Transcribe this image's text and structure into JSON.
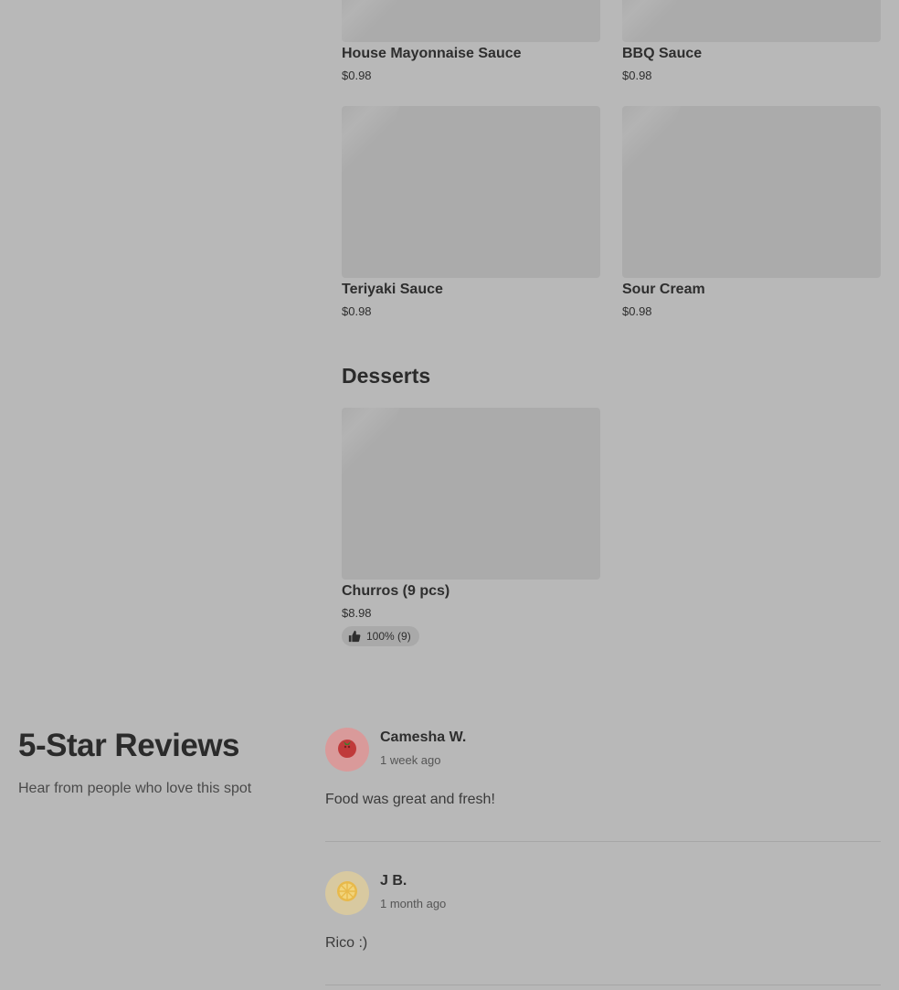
{
  "menu": {
    "items_top": [
      {
        "name": "House Mayonnaise Sauce",
        "price": "$0.98"
      },
      {
        "name": "BBQ Sauce",
        "price": "$0.98"
      },
      {
        "name": "Teriyaki Sauce",
        "price": "$0.98"
      },
      {
        "name": "Sour Cream",
        "price": "$0.98"
      }
    ],
    "desserts": {
      "title": "Desserts",
      "items": [
        {
          "name": "Churros (9 pcs)",
          "price": "$8.98",
          "rating": "100% (9)",
          "rating_icon": "thumbs-up-icon"
        }
      ]
    }
  },
  "reviews": {
    "title": "5-Star Reviews",
    "subtitle": "Hear from people who love this spot",
    "list": [
      {
        "name": "Camesha W.",
        "time": "1 week ago",
        "text": "Food was great and fresh!",
        "avatar_icon": "tomato-icon",
        "avatar_color": "#d99a9a"
      },
      {
        "name": "J B.",
        "time": "1 month ago",
        "text": "Rico :)",
        "avatar_icon": "lemon-slice-icon",
        "avatar_color": "#d8c9a0"
      }
    ]
  },
  "colors": {
    "background": "#b8b8b8",
    "image_placeholder": "#ababab",
    "text": "#2e2e2e"
  }
}
